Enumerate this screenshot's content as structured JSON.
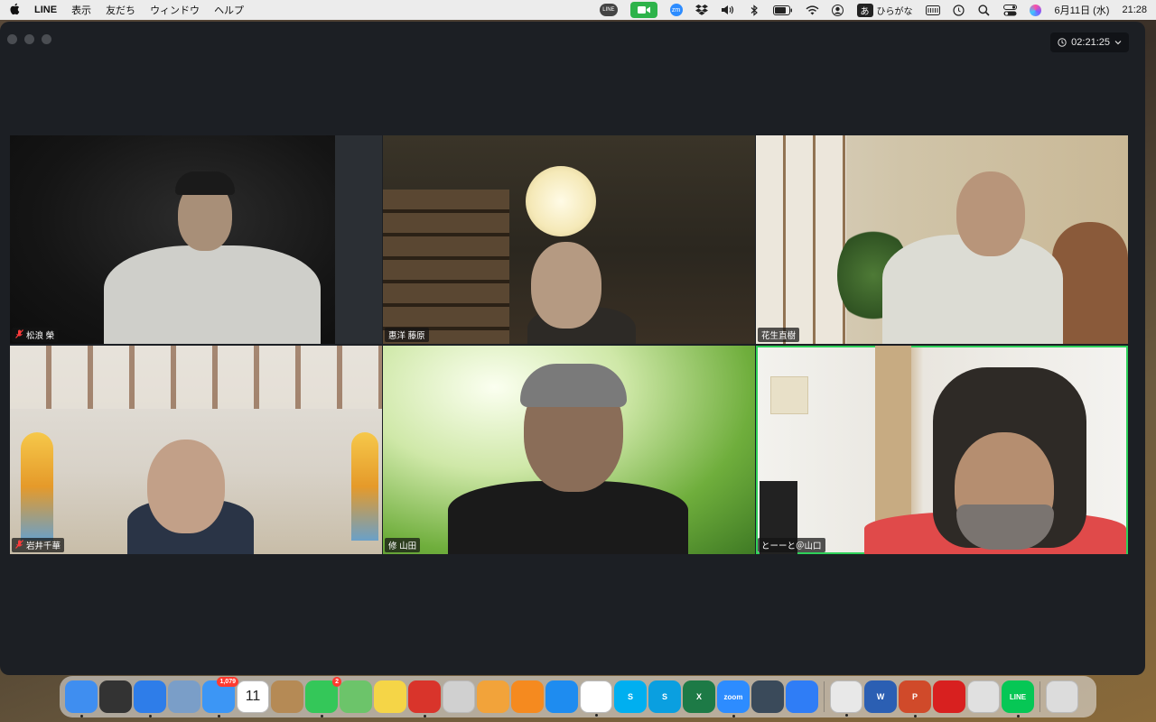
{
  "menubar": {
    "apple": "",
    "app_name": "LINE",
    "menus": [
      "表示",
      "友だち",
      "ウィンドウ",
      "ヘルプ"
    ],
    "ime_char": "あ",
    "ime_mode": "ひらがな",
    "date": "6月11日 (水)",
    "time": "21:28"
  },
  "meeting": {
    "elapsed": "02:21:25",
    "participants": [
      {
        "name": "松浪 榮",
        "muted": true,
        "active": false
      },
      {
        "name": "惠洋 藤原",
        "muted": false,
        "active": false
      },
      {
        "name": "花生直樹",
        "muted": false,
        "active": false
      },
      {
        "name": "岩井千華",
        "muted": true,
        "active": false
      },
      {
        "name": "修 山田",
        "muted": false,
        "active": false
      },
      {
        "name": "とーーと＠山口",
        "muted": false,
        "active": true
      }
    ]
  },
  "dock": {
    "items": [
      {
        "name": "Finder",
        "icon": "finder-icon",
        "color": "#3f8ef0",
        "label": "",
        "badge": ""
      },
      {
        "name": "Mission Control",
        "icon": "mission-control-icon",
        "color": "#333333",
        "label": "",
        "badge": ""
      },
      {
        "name": "Safari",
        "icon": "safari-icon",
        "color": "#2e7de9",
        "label": "",
        "badge": ""
      },
      {
        "name": "Preview",
        "icon": "preview-icon",
        "color": "#7a9ec8",
        "label": "",
        "badge": ""
      },
      {
        "name": "Mail",
        "icon": "mail-icon",
        "color": "#3c96f5",
        "label": "",
        "badge": "1,079"
      },
      {
        "name": "Calendar",
        "icon": "calendar-icon",
        "color": "#ffffff",
        "label": "11",
        "badge": ""
      },
      {
        "name": "Contacts",
        "icon": "contacts-icon",
        "color": "#b58a55",
        "label": "",
        "badge": ""
      },
      {
        "name": "Messages",
        "icon": "messages-icon",
        "color": "#34c759",
        "label": "",
        "badge": "2"
      },
      {
        "name": "Maps",
        "icon": "maps-icon",
        "color": "#6cc46a",
        "label": "",
        "badge": ""
      },
      {
        "name": "Notes",
        "icon": "notes-icon",
        "color": "#f5d547",
        "label": "",
        "badge": ""
      },
      {
        "name": "Photo Booth",
        "icon": "photo-booth-icon",
        "color": "#d9342b",
        "label": "",
        "badge": ""
      },
      {
        "name": "Launchpad",
        "icon": "launchpad-icon",
        "color": "#d0d0d0",
        "label": "",
        "badge": ""
      },
      {
        "name": "Photos",
        "icon": "photos-icon",
        "color": "#f2a33a",
        "label": "",
        "badge": ""
      },
      {
        "name": "Books",
        "icon": "books-icon",
        "color": "#f58a1f",
        "label": "",
        "badge": ""
      },
      {
        "name": "App Store",
        "icon": "app-store-icon",
        "color": "#1e8cf0",
        "label": "",
        "badge": ""
      },
      {
        "name": "Reminders",
        "icon": "reminders-icon",
        "color": "#ffffff",
        "label": "",
        "badge": ""
      },
      {
        "name": "Skype",
        "icon": "skype-icon",
        "color": "#00aff0",
        "label": "S",
        "badge": ""
      },
      {
        "name": "Skype",
        "icon": "skype-icon",
        "color": "#0a9fe0",
        "label": "S",
        "badge": ""
      },
      {
        "name": "Excel",
        "icon": "excel-icon",
        "color": "#1d7a46",
        "label": "X",
        "badge": ""
      },
      {
        "name": "Zoom",
        "icon": "zoom-icon",
        "color": "#2d8cff",
        "label": "zoom",
        "badge": ""
      },
      {
        "name": "Preview Prism",
        "icon": "prism-icon",
        "color": "#3a4a5a",
        "label": "",
        "badge": ""
      },
      {
        "name": "Messenger",
        "icon": "messenger-icon",
        "color": "#2f7df6",
        "label": "",
        "badge": ""
      },
      {
        "name": "Chrome",
        "icon": "chrome-icon",
        "color": "#e8e8e8",
        "label": "",
        "badge": ""
      },
      {
        "name": "Word",
        "icon": "word-icon",
        "color": "#2b5fb3",
        "label": "W",
        "badge": ""
      },
      {
        "name": "PowerPoint",
        "icon": "powerpoint-icon",
        "color": "#d04a2a",
        "label": "P",
        "badge": ""
      },
      {
        "name": "Trend Micro",
        "icon": "trend-micro-icon",
        "color": "#d8201f",
        "label": "",
        "badge": ""
      },
      {
        "name": "Printer",
        "icon": "printer-icon",
        "color": "#e0e0e0",
        "label": "",
        "badge": ""
      },
      {
        "name": "LINE",
        "icon": "line-icon",
        "color": "#06c755",
        "label": "LINE",
        "badge": ""
      },
      {
        "name": "Trash",
        "icon": "trash-icon",
        "color": "#dcdcdc",
        "label": "",
        "badge": ""
      }
    ]
  }
}
